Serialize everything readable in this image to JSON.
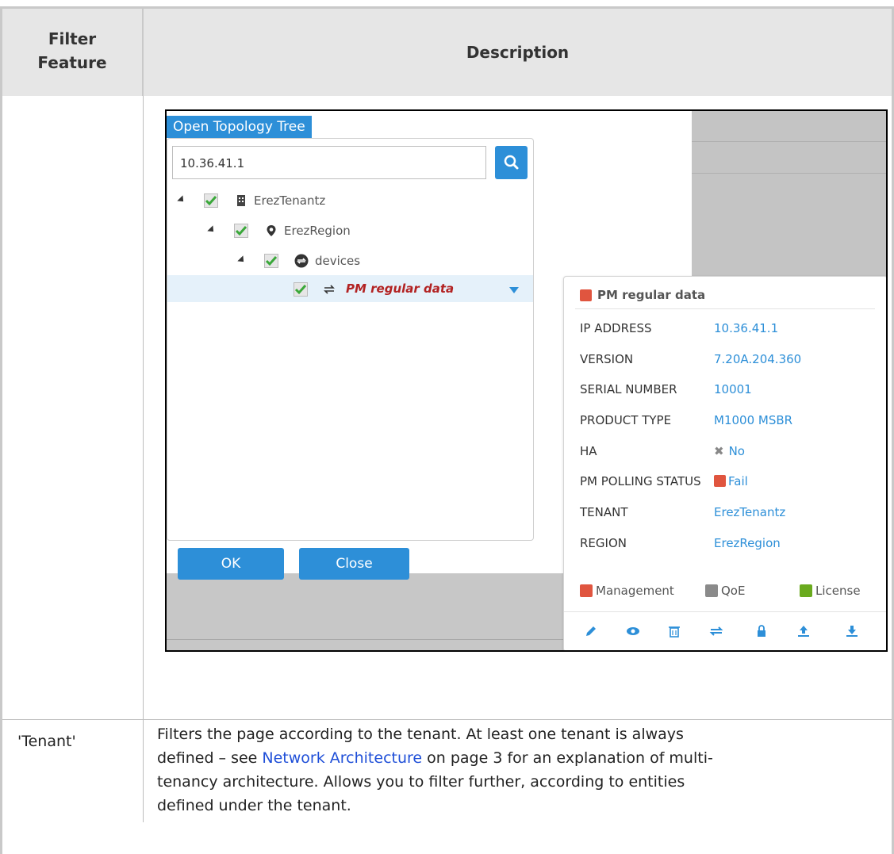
{
  "table": {
    "header": {
      "col1": "Filter\nFeature",
      "col2": "Description"
    },
    "rows": [
      {
        "feature": "",
        "screenshot": {
          "tree_title": "Open Topology Tree",
          "search_value": "10.36.41.1",
          "tree": [
            {
              "label": "ErezTenantz",
              "icon": "building-icon",
              "level": 0
            },
            {
              "label": "ErezRegion",
              "icon": "map-pin-icon",
              "level": 1
            },
            {
              "label": "devices",
              "icon": "device-group-icon",
              "level": 2
            },
            {
              "label": "PM regular data",
              "icon": "transfer-arrows-icon",
              "level": 3,
              "selected": true
            }
          ],
          "ok_label": "OK",
          "close_label": "Close",
          "card": {
            "title": "PM regular data",
            "fields": [
              {
                "key": "IP ADDRESS",
                "value": "10.36.41.1"
              },
              {
                "key": "VERSION",
                "value": "7.20A.204.360"
              },
              {
                "key": "SERIAL NUMBER",
                "value": "10001"
              },
              {
                "key": "PRODUCT TYPE",
                "value": "M1000 MSBR"
              },
              {
                "key": "HA",
                "value": "No"
              },
              {
                "key": "PM POLLING STATUS",
                "value": "Fail"
              },
              {
                "key": "TENANT",
                "value": "ErezTenantz"
              },
              {
                "key": "REGION",
                "value": "ErezRegion"
              }
            ],
            "legend": [
              {
                "label": "Management",
                "color": "#e0553f"
              },
              {
                "label": "QoE",
                "color": "#8a8a8a"
              },
              {
                "label": "License",
                "color": "#6aaa1e"
              }
            ],
            "tools": [
              "edit-icon",
              "view-icon",
              "delete-icon",
              "sync-icon",
              "lock-icon",
              "upload-icon",
              "download-icon"
            ]
          }
        }
      },
      {
        "feature": "'Tenant'",
        "description": {
          "line1": "Filters the page according to the tenant. At least one tenant is always",
          "line2_pre": "defined – see ",
          "line2_link": "Network Architecture",
          "line2_post": " on page 3 for an explanation of multi-",
          "line3": "tenancy architecture. Allows you to filter further, according to entities",
          "line4": "defined under the tenant."
        }
      }
    ]
  },
  "colors": {
    "accent": "#2d8fd8",
    "fail_red": "#e0553f",
    "link_blue": "#1f4fd8"
  }
}
